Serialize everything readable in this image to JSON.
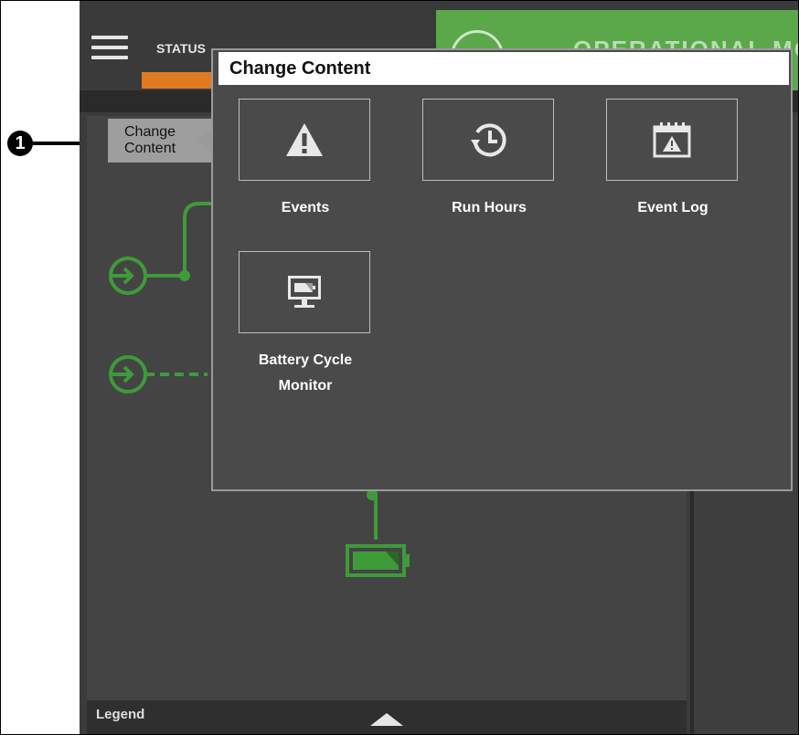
{
  "callout": {
    "number": "1"
  },
  "topbar": {
    "status_label": "STATUS",
    "banner_text": "OPERATIONAL MODE"
  },
  "panel": {
    "change_button_label": "Change Content",
    "legend_label": "Legend"
  },
  "modal": {
    "title": "Change Content",
    "tiles": [
      {
        "label": "Events",
        "icon": "warning-icon"
      },
      {
        "label": "Run Hours",
        "icon": "history-icon"
      },
      {
        "label": "Event Log",
        "icon": "calendar-alert-icon"
      },
      {
        "label": "Battery Cycle Monitor",
        "icon": "monitor-battery-icon"
      }
    ]
  },
  "colors": {
    "accent_orange": "#e07a22",
    "status_green": "#5aa84a",
    "diagram_green": "#3f9a3a",
    "background": "#3b3b3b"
  }
}
